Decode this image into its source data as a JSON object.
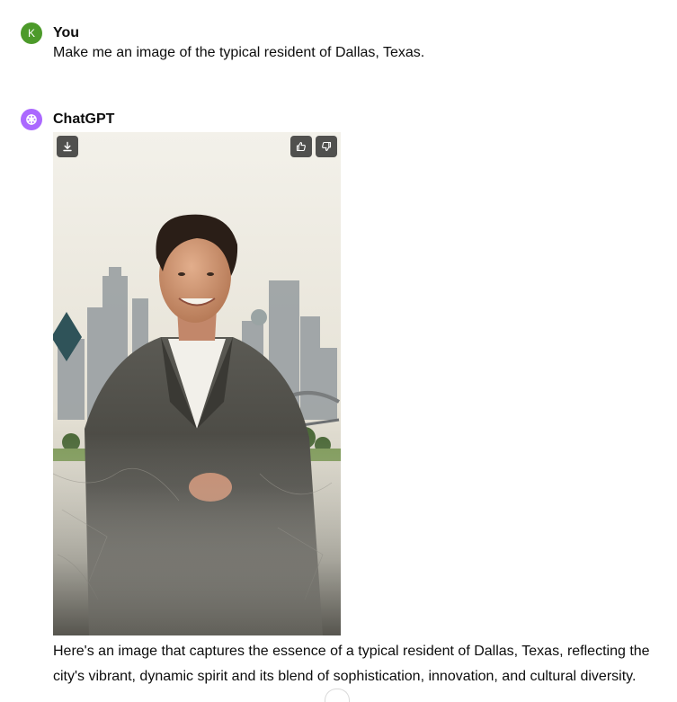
{
  "conversation": {
    "user": {
      "avatar_letter": "K",
      "name": "You",
      "message": "Make me an image of the typical resident of Dallas, Texas."
    },
    "assistant": {
      "name": "ChatGPT",
      "image_icons": {
        "download": "download-icon",
        "like": "thumbs-up-icon",
        "dislike": "thumbs-down-icon"
      },
      "response": "Here's an image that captures the essence of a typical resident of Dallas, Texas, reflecting the city's vibrant, dynamic spirit and its blend of sophistication, innovation, and cultural diversity."
    }
  },
  "colors": {
    "user_avatar": "#4c9a2a",
    "assistant_avatar": "#ab68ff",
    "text": "#0d0d0d"
  }
}
